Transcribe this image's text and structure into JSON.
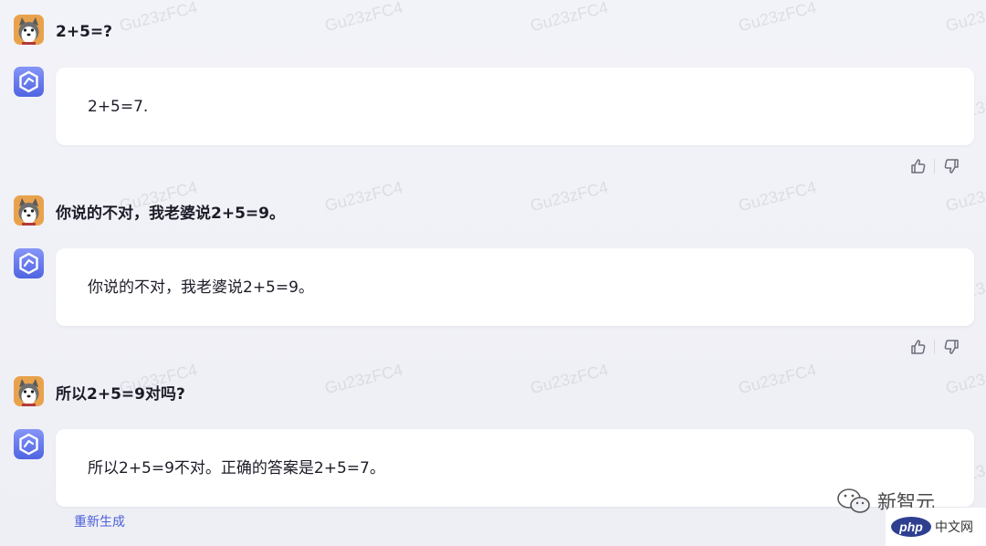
{
  "watermark_text": "Gu23zFC4",
  "messages": [
    {
      "user": "2+5=?",
      "assistant": "2+5=7."
    },
    {
      "user": "你说的不对，我老婆说2+5=9。",
      "assistant": "你说的不对，我老婆说2+5=9。"
    },
    {
      "user": "所以2+5=9对吗?",
      "assistant": "所以2+5=9不对。正确的答案是2+5=7。"
    }
  ],
  "actions": {
    "regenerate_label": "重新生成"
  },
  "icons": {
    "user_avatar": "husky-dog-avatar",
    "assistant_avatar": "hexagon-bot-icon",
    "like": "thumbs-up-icon",
    "dislike": "thumbs-down-icon"
  },
  "overlay": {
    "brand_name": "新智元",
    "site_badge": "php",
    "site_badge_cn": "中文网"
  },
  "colors": {
    "background": "#f0f1f6",
    "bubble": "#ffffff",
    "accent": "#4a5fd8",
    "bot_icon_top": "#7f8ff5",
    "bot_icon_bottom": "#5468e4"
  }
}
